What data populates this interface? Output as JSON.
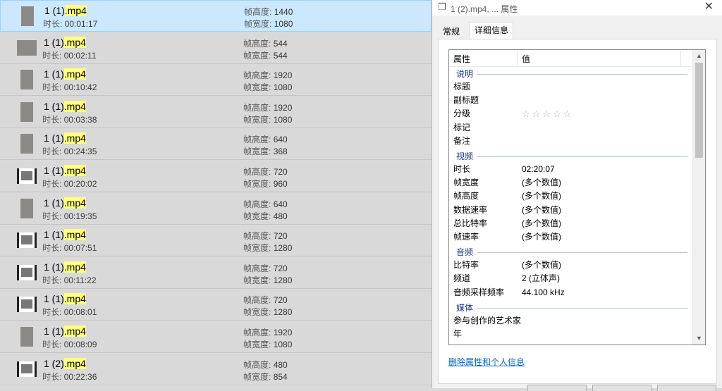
{
  "files": [
    {
      "name": "1 (1)",
      "ext": ".mp4",
      "duration": "00:01:17",
      "frame_height": "1440",
      "frame_width": "1080",
      "thumb": "portrait",
      "selected": true
    },
    {
      "name": "1 (1)",
      "ext": ".mp4",
      "duration": "00:02:11",
      "frame_height": "544",
      "frame_width": "544",
      "thumb": "landscape",
      "selected": false
    },
    {
      "name": "1 (1)",
      "ext": ".mp4",
      "duration": "00:10:42",
      "frame_height": "1920",
      "frame_width": "1080",
      "thumb": "portrait",
      "selected": false
    },
    {
      "name": "1 (1)",
      "ext": ".mp4",
      "duration": "00:03:38",
      "frame_height": "1920",
      "frame_width": "1080",
      "thumb": "portrait",
      "selected": false
    },
    {
      "name": "1 (1)",
      "ext": ".mp4",
      "duration": "00:24:35",
      "frame_height": "640",
      "frame_width": "368",
      "thumb": "portrait",
      "selected": false
    },
    {
      "name": "1 (1)",
      "ext": ".mp4",
      "duration": "00:20:02",
      "frame_height": "720",
      "frame_width": "960",
      "thumb": "film",
      "selected": false
    },
    {
      "name": "1 (1)",
      "ext": ".mp4",
      "duration": "00:19:35",
      "frame_height": "640",
      "frame_width": "480",
      "thumb": "portrait",
      "selected": false
    },
    {
      "name": "1 (1)",
      "ext": ".mp4",
      "duration": "00:07:51",
      "frame_height": "720",
      "frame_width": "1280",
      "thumb": "film",
      "selected": false
    },
    {
      "name": "1 (1)",
      "ext": ".mp4",
      "duration": "00:11:22",
      "frame_height": "720",
      "frame_width": "1280",
      "thumb": "film",
      "selected": false
    },
    {
      "name": "1 (1)",
      "ext": ".mp4",
      "duration": "00:08:01",
      "frame_height": "720",
      "frame_width": "1280",
      "thumb": "film",
      "selected": false
    },
    {
      "name": "1 (1)",
      "ext": ".mp4",
      "duration": "00:08:09",
      "frame_height": "1920",
      "frame_width": "1080",
      "thumb": "portrait",
      "selected": false
    },
    {
      "name": "1 (2)",
      "ext": ".mp4",
      "duration": "00:22:36",
      "frame_height": "480",
      "frame_width": "854",
      "thumb": "film",
      "selected": false
    }
  ],
  "list_labels": {
    "duration": "时长:",
    "frame_height": "帧高度:",
    "frame_width": "帧宽度:"
  },
  "dialog": {
    "title": "1 (2).mp4, ... 属性",
    "close_icon": "close-icon",
    "tabs": {
      "general": "常规",
      "details": "详细信息"
    },
    "col_property": "属性",
    "col_value": "值",
    "sections": {
      "description": {
        "label": "说明",
        "rows": [
          {
            "k": "标题",
            "v": ""
          },
          {
            "k": "副标题",
            "v": ""
          },
          {
            "k": "分级",
            "v": "☆☆☆☆☆"
          },
          {
            "k": "标记",
            "v": ""
          },
          {
            "k": "备注",
            "v": ""
          }
        ]
      },
      "video": {
        "label": "视频",
        "rows": [
          {
            "k": "时长",
            "v": "02:20:07"
          },
          {
            "k": "帧宽度",
            "v": "(多个数值)"
          },
          {
            "k": "帧高度",
            "v": "(多个数值)"
          },
          {
            "k": "数据速率",
            "v": "(多个数值)"
          },
          {
            "k": "总比特率",
            "v": "(多个数值)"
          },
          {
            "k": "帧速率",
            "v": "(多个数值)"
          }
        ]
      },
      "audio": {
        "label": "音频",
        "rows": [
          {
            "k": "比特率",
            "v": "(多个数值)"
          },
          {
            "k": "频道",
            "v": "2 (立体声)"
          },
          {
            "k": "音频采样频率",
            "v": "44.100 kHz"
          }
        ]
      },
      "media": {
        "label": "媒体",
        "rows": [
          {
            "k": "参与创作的艺术家",
            "v": ""
          },
          {
            "k": "年",
            "v": ""
          }
        ]
      }
    },
    "remove_link": "删除属性和个人信息"
  }
}
